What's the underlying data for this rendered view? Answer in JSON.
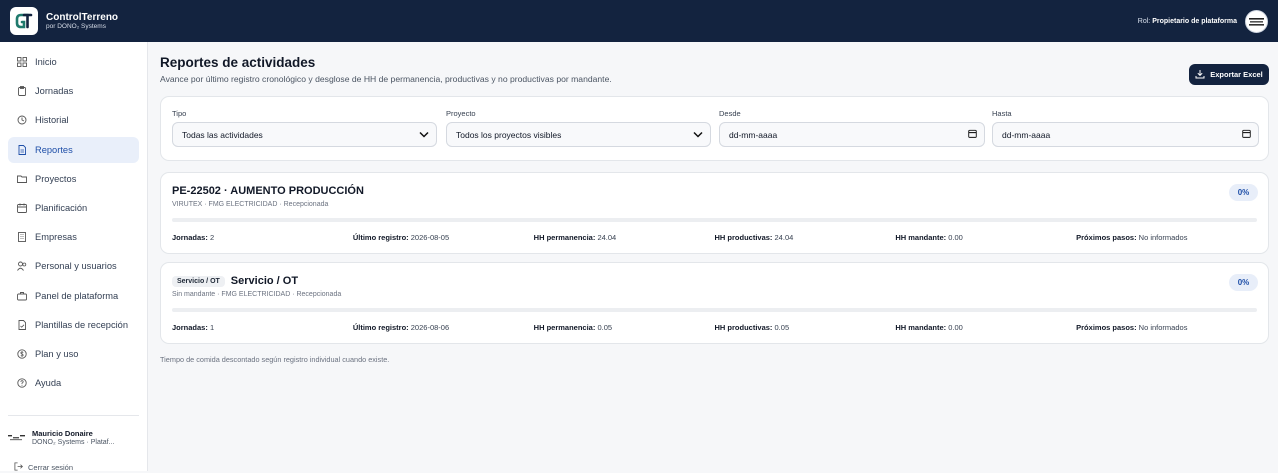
{
  "app": {
    "name": "ControlTerreno",
    "subtitle": "por DONO₂ Systems",
    "role_label": "Rol:",
    "role_value": "Propietario de plataforma"
  },
  "sidebar": {
    "items": [
      {
        "label": "Inicio",
        "icon": "grid-icon"
      },
      {
        "label": "Jornadas",
        "icon": "clipboard-icon"
      },
      {
        "label": "Historial",
        "icon": "history-icon"
      },
      {
        "label": "Reportes",
        "icon": "document-icon",
        "active": true
      },
      {
        "label": "Proyectos",
        "icon": "folder-icon"
      },
      {
        "label": "Planificación",
        "icon": "calendar-icon"
      },
      {
        "label": "Empresas",
        "icon": "building-icon"
      },
      {
        "label": "Personal y usuarios",
        "icon": "users-icon"
      },
      {
        "label": "Panel de plataforma",
        "icon": "briefcase-icon"
      },
      {
        "label": "Plantillas de recepción",
        "icon": "template-icon"
      },
      {
        "label": "Plan y uso",
        "icon": "dollar-icon"
      },
      {
        "label": "Ayuda",
        "icon": "help-icon"
      }
    ],
    "user": {
      "name": "Mauricio Donaire",
      "org": "DONO₂ Systems · Plataf..."
    },
    "logout_label": "Cerrar sesión"
  },
  "page": {
    "title": "Reportes de actividades",
    "subtitle": "Avance por último registro cronológico y desglose de HH de permanencia, productivas y no productivas por mandante.",
    "export_label": "Exportar Excel"
  },
  "filters": {
    "tipo": {
      "label": "Tipo",
      "value": "Todas las actividades"
    },
    "proyecto": {
      "label": "Proyecto",
      "value": "Todos los proyectos visibles"
    },
    "desde": {
      "label": "Desde",
      "value": "dd-mm-aaaa"
    },
    "hasta": {
      "label": "Hasta",
      "value": "dd-mm-aaaa"
    }
  },
  "reports": [
    {
      "chip": "",
      "title": "PE-22502 · AUMENTO PRODUCCIÓN",
      "meta": "VIRUTEX · FMG ELECTRICIDAD · Recepcionada",
      "percent_label": "0%",
      "progress": 0,
      "stats": {
        "jornadas_label": "Jornadas:",
        "jornadas": "2",
        "ultimo_label": "Último registro:",
        "ultimo": "2026-08-05",
        "perm_label": "HH permanencia:",
        "perm": "24.04",
        "prod_label": "HH productivas:",
        "prod": "24.04",
        "mand_label": "HH mandante:",
        "mand": "0.00",
        "pasos_label": "Próximos pasos:",
        "pasos": "No informados"
      }
    },
    {
      "chip": "Servicio / OT",
      "title": "Servicio / OT",
      "meta": "Sin mandante · FMG ELECTRICIDAD · Recepcionada",
      "percent_label": "0%",
      "progress": 0,
      "stats": {
        "jornadas_label": "Jornadas:",
        "jornadas": "1",
        "ultimo_label": "Último registro:",
        "ultimo": "2026-08-06",
        "perm_label": "HH permanencia:",
        "perm": "0.05",
        "prod_label": "HH productivas:",
        "prod": "0.05",
        "mand_label": "HH mandante:",
        "mand": "0.00",
        "pasos_label": "Próximos pasos:",
        "pasos": "No informados"
      }
    }
  ],
  "footnote": "Tiempo de comida descontado según registro individual cuando existe.",
  "colors": {
    "navy": "#13233f",
    "accent": "#1f4fa8",
    "active_bg": "#e9effa"
  }
}
